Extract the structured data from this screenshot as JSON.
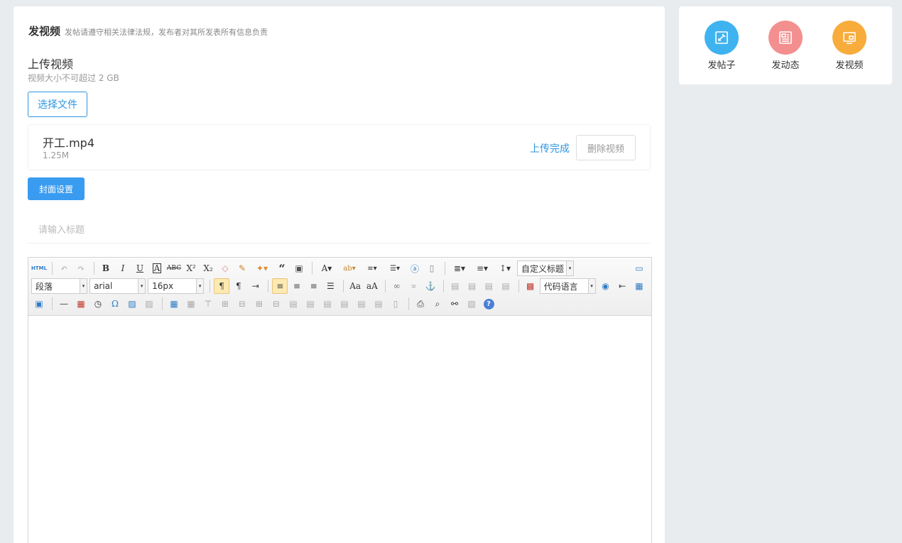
{
  "header": {
    "title": "发视频",
    "notice": "发帖请遵守相关法律法规，发布者对其所发表所有信息负责"
  },
  "upload": {
    "section_title": "上传视频",
    "hint": "视频大小不可超过 2 GB",
    "choose_label": "选择文件",
    "file": {
      "name": "开工.mp4",
      "size": "1.25M",
      "status": "上传完成",
      "delete_label": "删除视频"
    }
  },
  "cover_button": "封面设置",
  "title_input": {
    "placeholder": "请输入标题",
    "value": ""
  },
  "editor": {
    "html_label": "HTML",
    "custom_heading": "自定义标题",
    "paragraph": "段落",
    "font_family": "arial",
    "font_size": "16px",
    "code_language": "代码语言"
  },
  "sidebar": {
    "options": [
      {
        "label": "发帖子",
        "color": "#3fb3f0",
        "icon": "edit-icon"
      },
      {
        "label": "发动态",
        "color": "#f48f8f",
        "icon": "news-icon"
      },
      {
        "label": "发视频",
        "color": "#f8ac3c",
        "icon": "video-icon"
      }
    ]
  },
  "colors": {
    "accent": "#2d96e0",
    "primary_button": "#3a9cf0",
    "background": "#e9ecef"
  }
}
